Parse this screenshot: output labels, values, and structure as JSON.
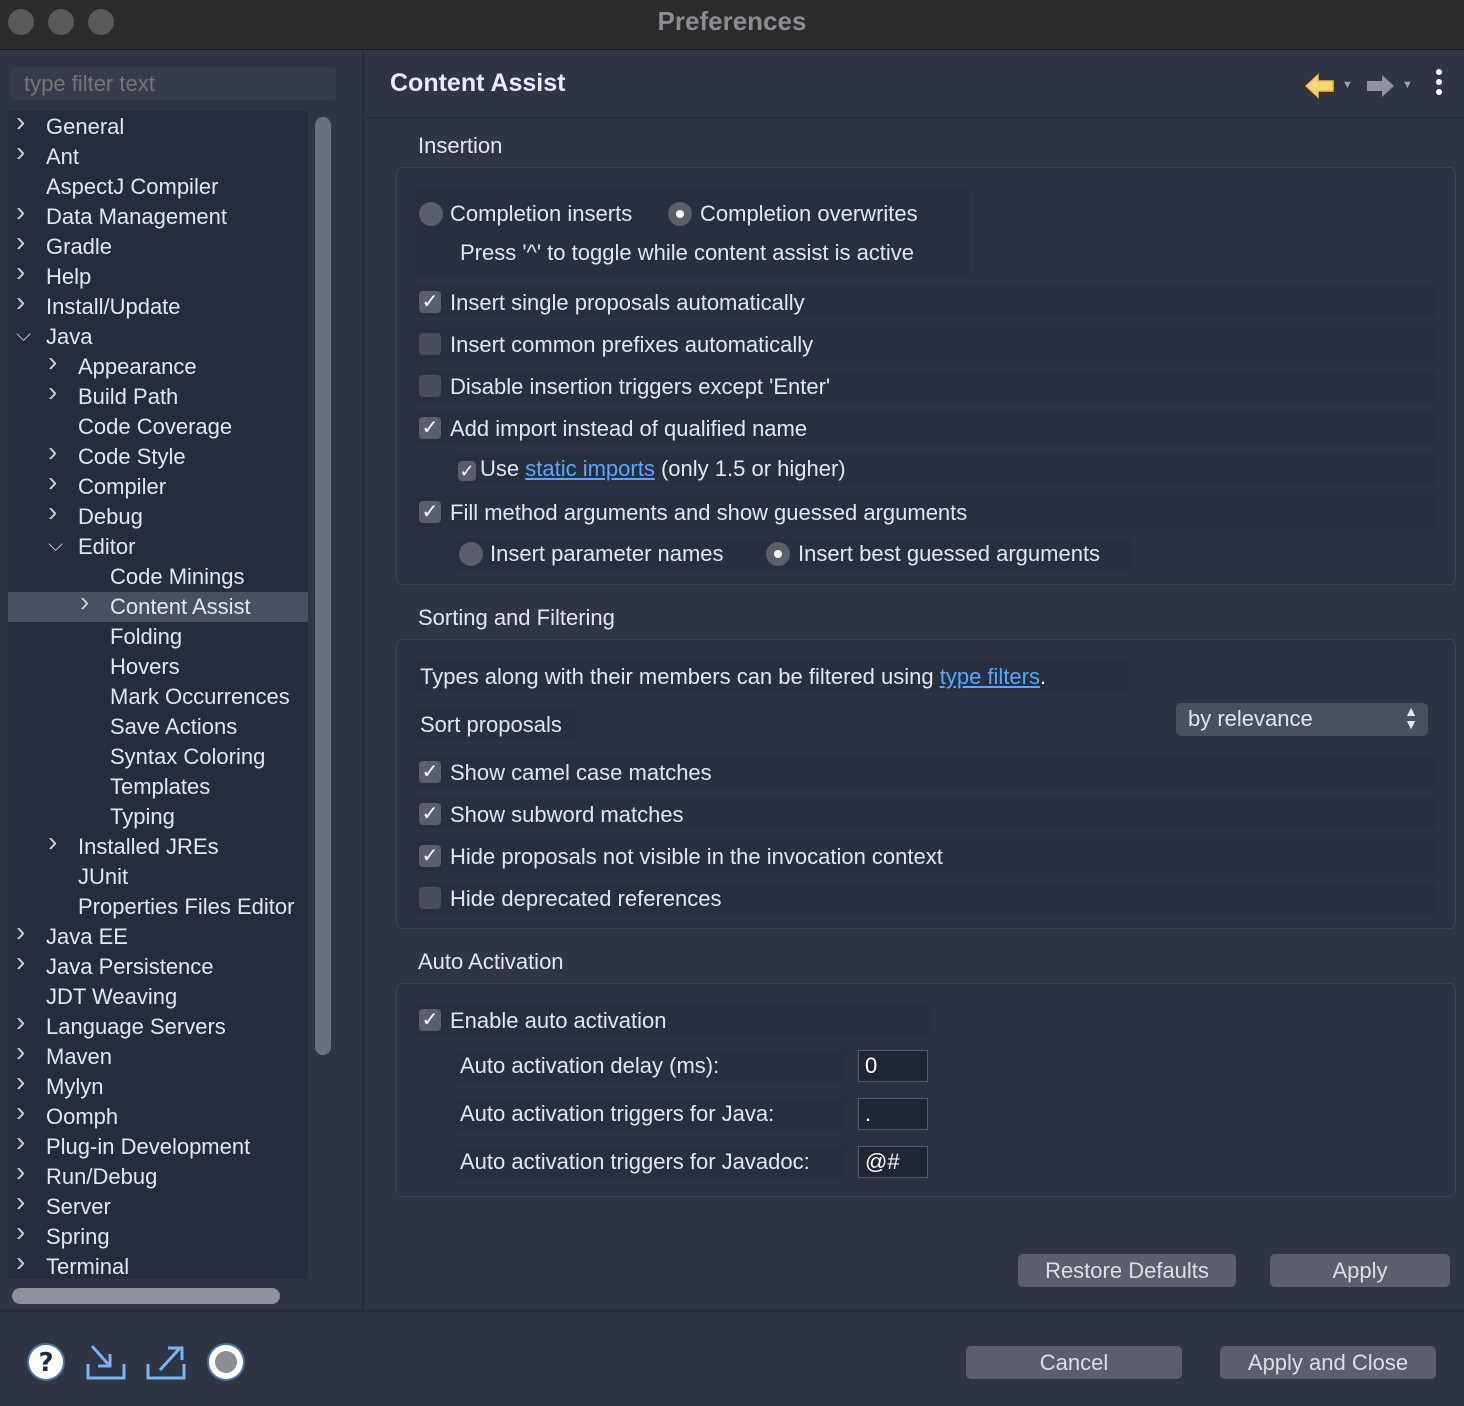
{
  "window": {
    "title": "Preferences"
  },
  "filter": {
    "placeholder": "type filter text"
  },
  "tree": [
    {
      "label": "General",
      "level": 0,
      "chevron": "right"
    },
    {
      "label": "Ant",
      "level": 0,
      "chevron": "right"
    },
    {
      "label": "AspectJ Compiler",
      "level": 0,
      "chevron": ""
    },
    {
      "label": "Data Management",
      "level": 0,
      "chevron": "right"
    },
    {
      "label": "Gradle",
      "level": 0,
      "chevron": "right"
    },
    {
      "label": "Help",
      "level": 0,
      "chevron": "right"
    },
    {
      "label": "Install/Update",
      "level": 0,
      "chevron": "right"
    },
    {
      "label": "Java",
      "level": 0,
      "chevron": "down"
    },
    {
      "label": "Appearance",
      "level": 1,
      "chevron": "right"
    },
    {
      "label": "Build Path",
      "level": 1,
      "chevron": "right"
    },
    {
      "label": "Code Coverage",
      "level": 1,
      "chevron": ""
    },
    {
      "label": "Code Style",
      "level": 1,
      "chevron": "right"
    },
    {
      "label": "Compiler",
      "level": 1,
      "chevron": "right"
    },
    {
      "label": "Debug",
      "level": 1,
      "chevron": "right"
    },
    {
      "label": "Editor",
      "level": 1,
      "chevron": "down"
    },
    {
      "label": "Code Minings",
      "level": 2,
      "chevron": ""
    },
    {
      "label": "Content Assist",
      "level": 2,
      "chevron": "right",
      "selected": true
    },
    {
      "label": "Folding",
      "level": 2,
      "chevron": ""
    },
    {
      "label": "Hovers",
      "level": 2,
      "chevron": ""
    },
    {
      "label": "Mark Occurrences",
      "level": 2,
      "chevron": ""
    },
    {
      "label": "Save Actions",
      "level": 2,
      "chevron": ""
    },
    {
      "label": "Syntax Coloring",
      "level": 2,
      "chevron": ""
    },
    {
      "label": "Templates",
      "level": 2,
      "chevron": ""
    },
    {
      "label": "Typing",
      "level": 2,
      "chevron": ""
    },
    {
      "label": "Installed JREs",
      "level": 1,
      "chevron": "right"
    },
    {
      "label": "JUnit",
      "level": 1,
      "chevron": ""
    },
    {
      "label": "Properties Files Editor",
      "level": 1,
      "chevron": ""
    },
    {
      "label": "Java EE",
      "level": 0,
      "chevron": "right"
    },
    {
      "label": "Java Persistence",
      "level": 0,
      "chevron": "right"
    },
    {
      "label": "JDT Weaving",
      "level": 0,
      "chevron": ""
    },
    {
      "label": "Language Servers",
      "level": 0,
      "chevron": "right"
    },
    {
      "label": "Maven",
      "level": 0,
      "chevron": "right"
    },
    {
      "label": "Mylyn",
      "level": 0,
      "chevron": "right"
    },
    {
      "label": "Oomph",
      "level": 0,
      "chevron": "right"
    },
    {
      "label": "Plug-in Development",
      "level": 0,
      "chevron": "right"
    },
    {
      "label": "Run/Debug",
      "level": 0,
      "chevron": "right"
    },
    {
      "label": "Server",
      "level": 0,
      "chevron": "right"
    },
    {
      "label": "Spring",
      "level": 0,
      "chevron": "right"
    },
    {
      "label": "Terminal",
      "level": 0,
      "chevron": "right"
    }
  ],
  "page": {
    "title": "Content Assist",
    "back_icon": "back-arrow-icon",
    "forward_icon": "forward-arrow-icon",
    "menu_icon": "kebab-menu-icon"
  },
  "insertion": {
    "title": "Insertion",
    "completion_inserts": "Completion inserts",
    "completion_overwrites": "Completion overwrites",
    "toggle_hint": "Press '^' to toggle while content assist is active",
    "insert_single": "Insert single proposals automatically",
    "insert_common": "Insert common prefixes automatically",
    "disable_triggers": "Disable insertion triggers except 'Enter'",
    "add_import": "Add import instead of qualified name",
    "use_prefix": "Use",
    "static_imports_link": "static imports",
    "use_suffix": "(only 1.5 or higher)",
    "fill_method": "Fill method arguments and show guessed arguments",
    "insert_param_names": "Insert parameter names",
    "insert_best_guessed": "Insert best guessed arguments"
  },
  "sorting": {
    "title": "Sorting and Filtering",
    "types_prefix": "Types along with their members can be filtered using",
    "type_filters_link": "type filters",
    "types_suffix": ".",
    "sort_label": "Sort proposals",
    "sort_value": "by relevance",
    "camel_case": "Show camel case matches",
    "subword": "Show subword matches",
    "hide_not_visible": "Hide proposals not visible in the invocation context",
    "hide_deprecated": "Hide deprecated references"
  },
  "auto": {
    "title": "Auto Activation",
    "enable": "Enable auto activation",
    "delay_label": "Auto activation delay (ms):",
    "delay_value": "0",
    "java_label": "Auto activation triggers for Java:",
    "java_value": ".",
    "javadoc_label": "Auto activation triggers for Javadoc:",
    "javadoc_value": "@#"
  },
  "buttons": {
    "restore_defaults": "Restore Defaults",
    "apply": "Apply",
    "cancel": "Cancel",
    "apply_and_close": "Apply and Close"
  },
  "footer_icons": [
    "help-icon",
    "import-icon",
    "export-icon",
    "record-icon"
  ]
}
